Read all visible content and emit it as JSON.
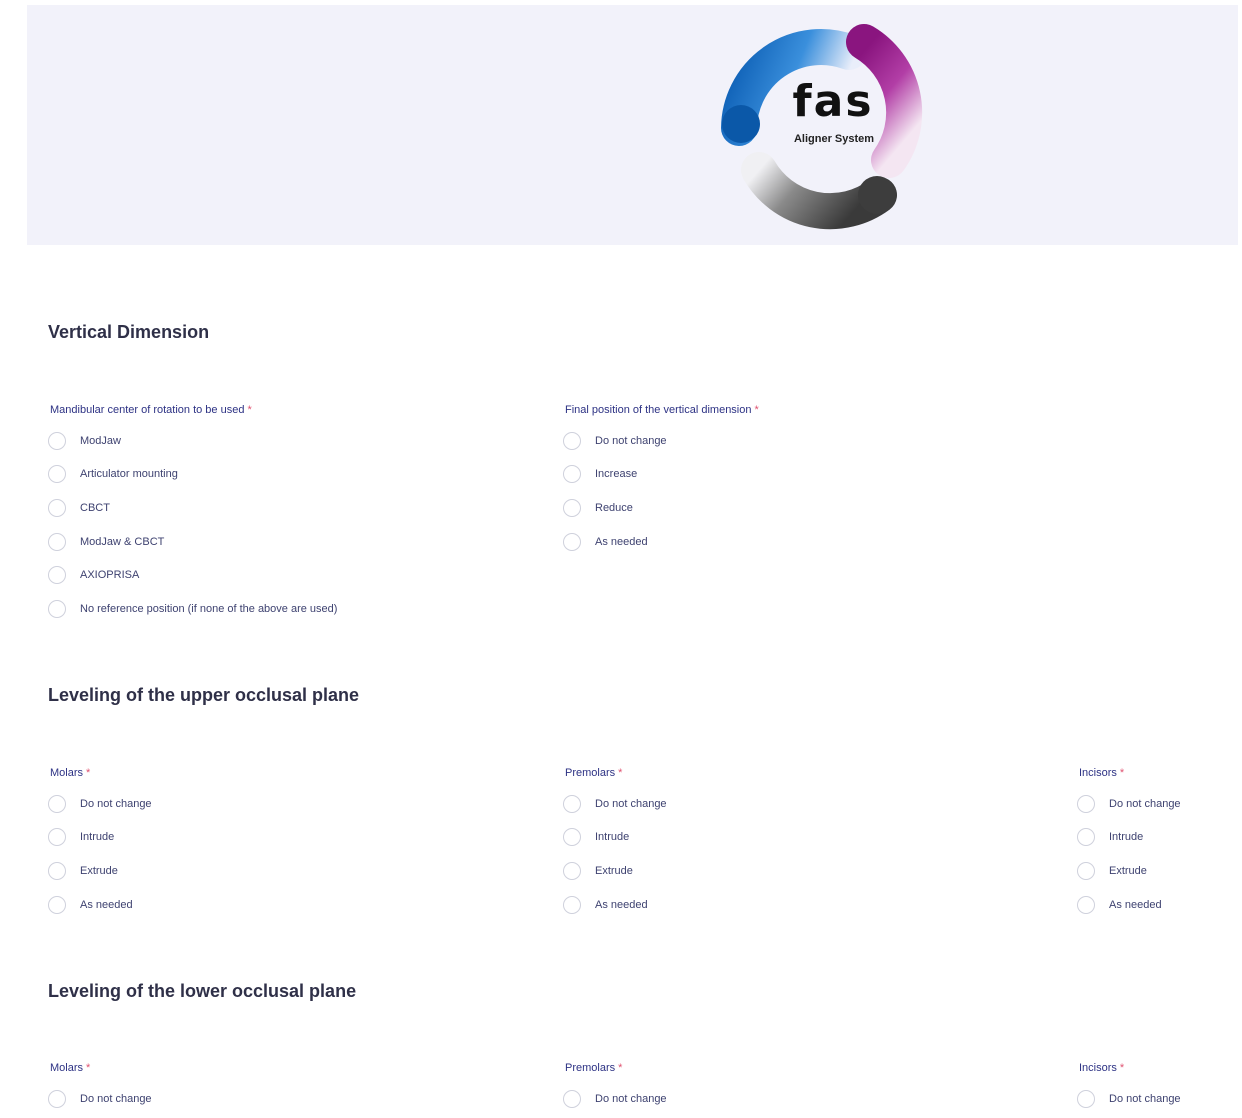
{
  "header": {
    "logo": {
      "text": "fas",
      "subtitle": "Aligner System"
    }
  },
  "sections": {
    "vertical": {
      "title": "Vertical Dimension",
      "mandibular": {
        "label": "Mandibular center of rotation to be used",
        "required": "*",
        "options": [
          "ModJaw",
          "Articulator mounting",
          "CBCT",
          "ModJaw & CBCT",
          "AXIOPRISA",
          "No reference position (if none of the above are used)"
        ]
      },
      "final_position": {
        "label": "Final position of the vertical dimension",
        "required": "*",
        "options": [
          "Do not change",
          "Increase",
          "Reduce",
          "As needed"
        ]
      }
    },
    "upper": {
      "title": "Leveling of the upper occlusal plane",
      "molars": {
        "label": "Molars",
        "required": "*",
        "options": [
          "Do not change",
          "Intrude",
          "Extrude",
          "As needed"
        ]
      },
      "premolars": {
        "label": "Premolars",
        "required": "*",
        "options": [
          "Do not change",
          "Intrude",
          "Extrude",
          "As needed"
        ]
      },
      "incisors": {
        "label": "Incisors",
        "required": "*",
        "options": [
          "Do not change",
          "Intrude",
          "Extrude",
          "As needed"
        ]
      }
    },
    "lower": {
      "title": "Leveling of the lower occlusal plane",
      "molars": {
        "label": "Molars",
        "required": "*",
        "options": [
          "Do not change"
        ]
      },
      "premolars": {
        "label": "Premolars",
        "required": "*",
        "options": [
          "Do not change"
        ]
      },
      "incisors": {
        "label": "Incisors",
        "required": "*",
        "options": [
          "Do not change"
        ]
      }
    }
  },
  "colors": {
    "header_bg": "#f2f2fa",
    "label": "#2d3284",
    "required": "#e05270",
    "logo_blue": "#1d74c8",
    "logo_magenta": "#9a1c8e",
    "logo_gray": "#4a4a4a"
  }
}
